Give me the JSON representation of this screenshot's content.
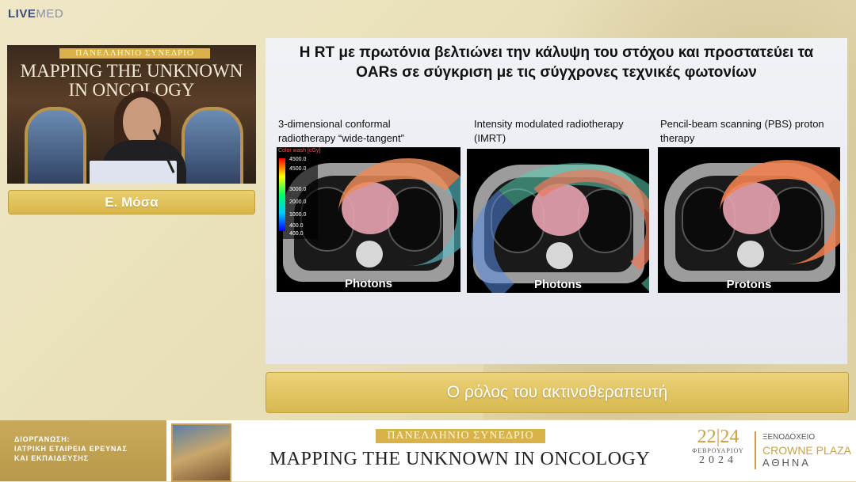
{
  "app": {
    "logo_live": "LIVE",
    "logo_med": "MED"
  },
  "speaker": {
    "video_banner": "ΠΑΝΕΛΛΗΝΙΟ ΣΥΝΕΔΡΙΟ",
    "video_title_line1": "MAPPING THE UNKNOWN",
    "video_title_line2": "IN ONCOLOGY",
    "name": "Ε. Μόσα"
  },
  "slide": {
    "title": "Η RT με πρωτόνια βελτιώνει την κάλυψη του στόχου και προστατεύει τα OARs σε σύγκριση με τις σύγχρονες τεχνικές φωτονίων",
    "panels": [
      {
        "caption": "3-dimensional conformal radiotherapy “wide-tangent”",
        "label": "Photons"
      },
      {
        "caption": "Intensity modulated radiotherapy (IMRT)",
        "label": "Photons"
      },
      {
        "caption": "Pencil-beam scanning (PBS) proton therapy",
        "label": "Protons"
      }
    ],
    "colorbar": {
      "title": "Color wash [cGy]",
      "ticks": [
        "4500.0",
        "4500.0",
        "3000.0",
        "2000.0",
        "1000.0",
        "400.0",
        "400.0"
      ]
    }
  },
  "subtitle": "Ο ρόλος του ακτινοθεραπευτή",
  "footer": {
    "org_line1": "ΔΙΟΡΓΑΝΩΣΗ:",
    "org_line2": "ΙΑΤΡΙΚΗ ΕΤΑΙΡΕΙΑ ΕΡΕΥΝΑΣ",
    "org_line3": "ΚΑΙ ΕΚΠΑΙΔΕΥΣΗΣ",
    "banner": "ΠΑΝΕΛΛΗΝΙΟ ΣΥΝΕΔΡΙΟ",
    "title": "MAPPING THE UNKNOWN IN ONCOLOGY",
    "date_days": "22|24",
    "date_month": "ΦΕΒΡΟΥΑΡΙΟΥ",
    "date_year": "2024",
    "venue_line1": "ΞΕΝΟΔΟΧΕΙΟ",
    "venue_line2": "CROWNE PLAZA",
    "venue_line3": "ΑΘΗΝΑ"
  }
}
